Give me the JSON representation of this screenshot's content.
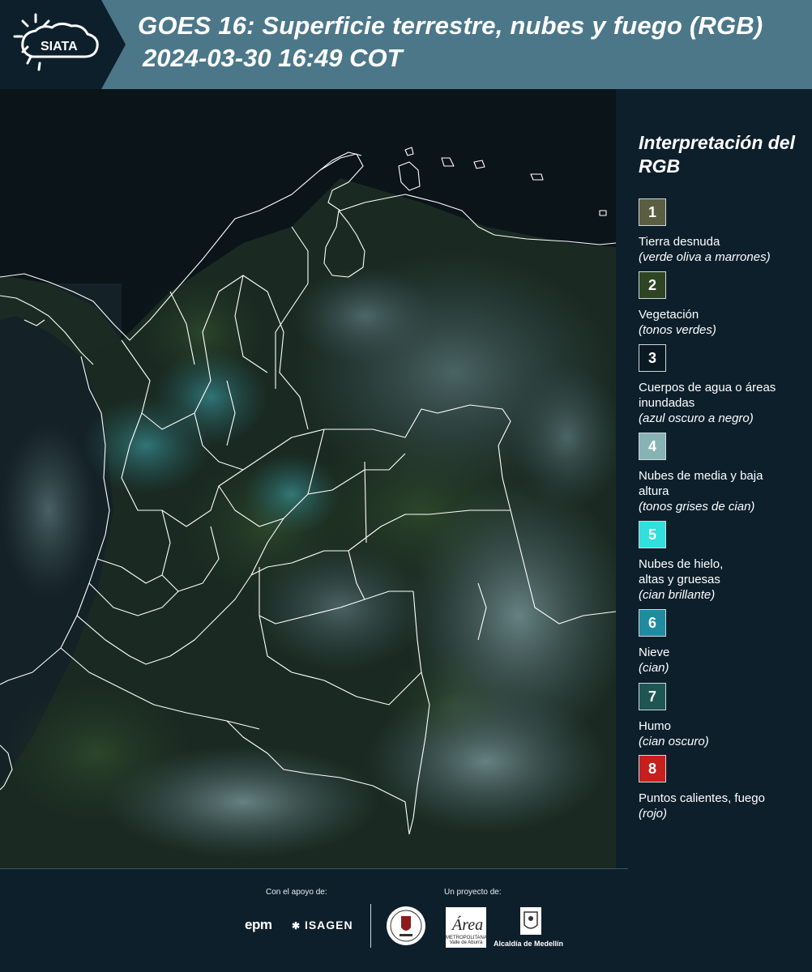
{
  "header": {
    "logo_text": "SIATA",
    "title_line1": "GOES 16: Superficie terrestre, nubes y fuego (RGB)",
    "title_line2": "2024-03-30 16:49 COT"
  },
  "legend": {
    "title": "Interpretación del RGB",
    "items": [
      {
        "num": "1",
        "label": "Tierra desnuda",
        "desc": "(verde oliva a marrones)",
        "color": "#5b5e41"
      },
      {
        "num": "2",
        "label": "Vegetación",
        "desc": "(tonos verdes)",
        "color": "#2e4423"
      },
      {
        "num": "3",
        "label": "Cuerpos de agua o áreas inundadas",
        "desc": "(azul oscuro a negro)",
        "color": "#0b1a22"
      },
      {
        "num": "4",
        "label": "Nubes de media y baja altura",
        "desc": "(tonos grises de cian)",
        "color": "#87b3b5"
      },
      {
        "num": "5",
        "label": "Nubes de hielo, altas y gruesas",
        "desc": "(cian brillante)",
        "color": "#2fe0de"
      },
      {
        "num": "6",
        "label": "Nieve",
        "desc": "(cian)",
        "color": "#1f8ba0"
      },
      {
        "num": "7",
        "label": "Humo",
        "desc": "(cian oscuro)",
        "color": "#1e5654"
      },
      {
        "num": "8",
        "label": "Puntos calientes, fuego",
        "desc": "(rojo)",
        "color": "#c71e1e"
      }
    ]
  },
  "footer": {
    "support_label": "Con el apoyo de:",
    "project_label": "Un proyecto de:",
    "sponsor_1": "epm",
    "sponsor_2": "ISAGEN",
    "partner_area": "Área Metropolitana",
    "partner_area_sub": "METROPOLITANA Valle de Aburrá",
    "partner_medellin": "Alcaldía de Medellín"
  },
  "colors": {
    "header_bg": "#4b7789",
    "page_bg": "#0d1f2b",
    "map_bg": "#0b1419",
    "border_white": "#ffffff"
  }
}
